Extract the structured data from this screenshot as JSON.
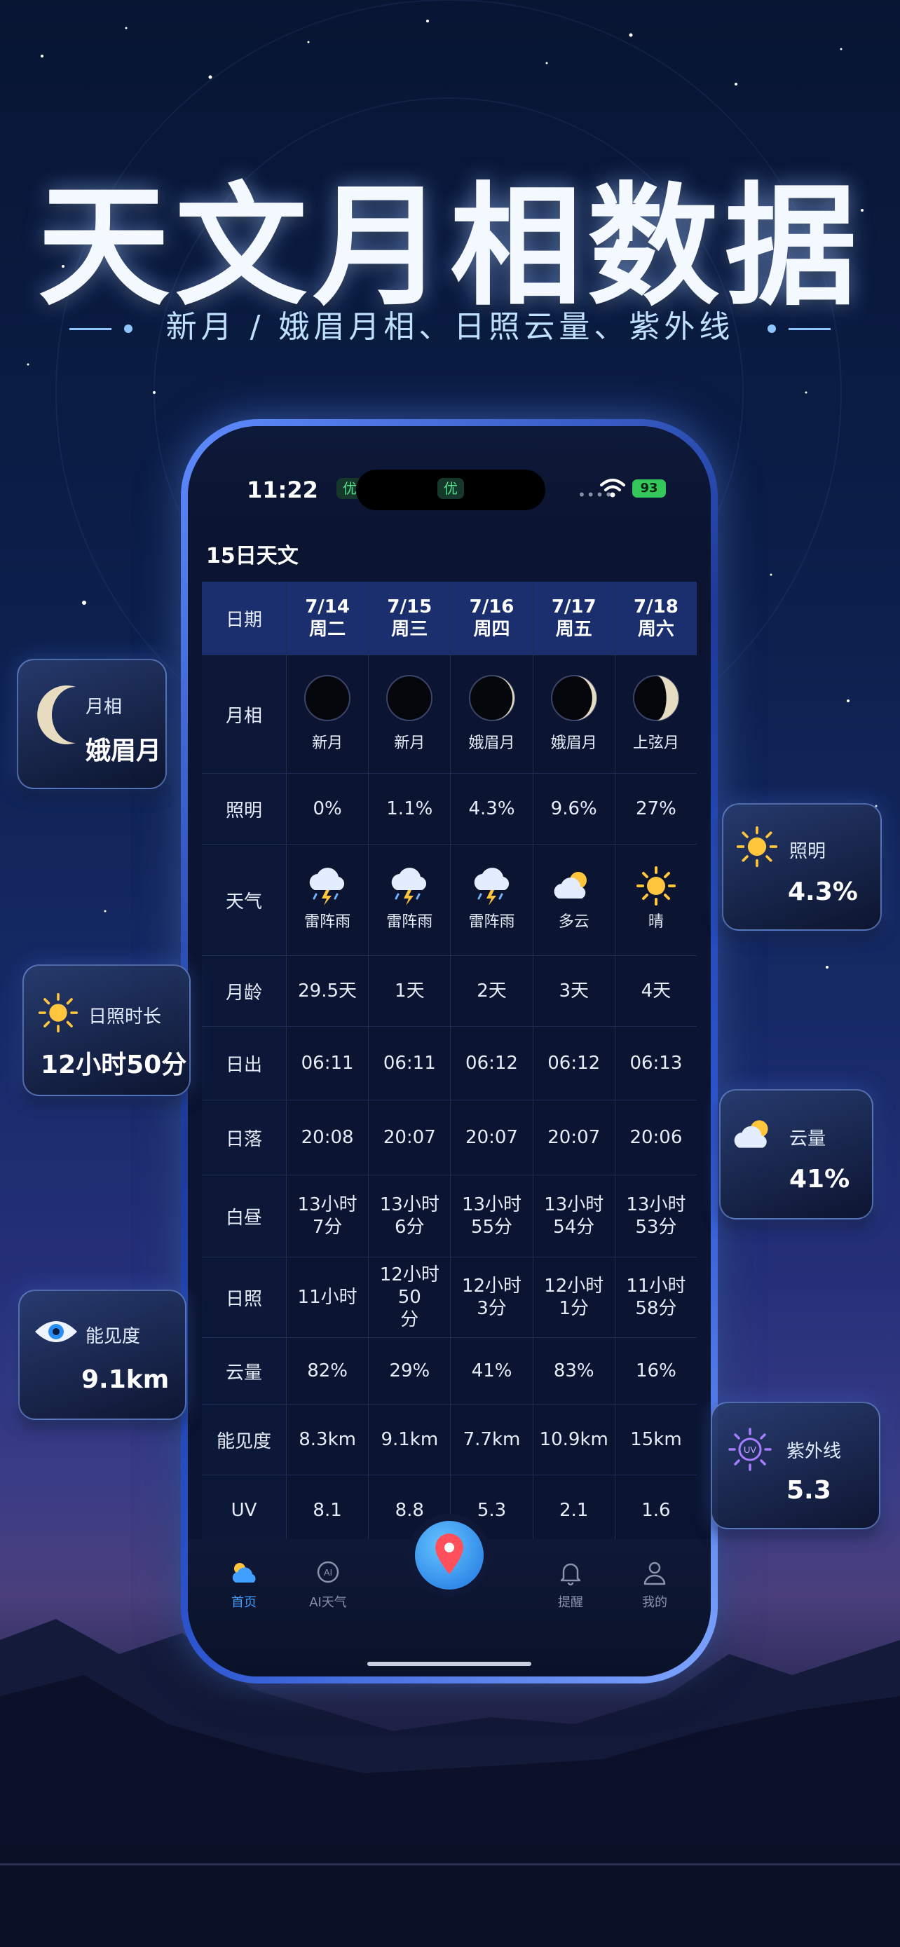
{
  "promo": {
    "headline": "天文月相数据",
    "subline": "新月 / 娥眉月相、日照云量、紫外线"
  },
  "status_bar": {
    "time": "11:22",
    "aqi_1": "优",
    "aqi_2": "优",
    "battery": "93"
  },
  "section_title": "15日天文",
  "table": {
    "header_label": "日期",
    "days": [
      {
        "date": "7/14",
        "weekday": "周二"
      },
      {
        "date": "7/15",
        "weekday": "周三"
      },
      {
        "date": "7/16",
        "weekday": "周四"
      },
      {
        "date": "7/17",
        "weekday": "周五"
      },
      {
        "date": "7/18",
        "weekday": "周六"
      }
    ],
    "rows": {
      "moon_phase": {
        "label": "月相",
        "values": [
          "新月",
          "新月",
          "娥眉月",
          "娥眉月",
          "上弦月"
        ],
        "illumination": [
          0,
          0.011,
          0.043,
          0.096,
          0.27
        ]
      },
      "illumination": {
        "label": "照明",
        "values": [
          "0%",
          "1.1%",
          "4.3%",
          "9.6%",
          "27%"
        ]
      },
      "weather": {
        "label": "天气",
        "values": [
          "雷阵雨",
          "雷阵雨",
          "雷阵雨",
          "多云",
          "晴"
        ],
        "icons": [
          "thunderstorm-icon",
          "thunderstorm-icon",
          "thunderstorm-icon",
          "partly-cloudy-icon",
          "sun-icon"
        ]
      },
      "moon_age": {
        "label": "月龄",
        "values": [
          "29.5天",
          "1天",
          "2天",
          "3天",
          "4天"
        ]
      },
      "sunrise": {
        "label": "日出",
        "values": [
          "06:11",
          "06:11",
          "06:12",
          "06:12",
          "06:13"
        ]
      },
      "sunset": {
        "label": "日落",
        "values": [
          "20:08",
          "20:07",
          "20:07",
          "20:07",
          "20:06"
        ]
      },
      "daylight": {
        "label": "白昼",
        "values": [
          [
            "13小时",
            "7分"
          ],
          [
            "13小时",
            "6分"
          ],
          [
            "13小时",
            "55分"
          ],
          [
            "13小时",
            "54分"
          ],
          [
            "13小时",
            "53分"
          ]
        ]
      },
      "sunshine": {
        "label": "日照",
        "values": [
          [
            "11小时",
            ""
          ],
          [
            "12小时50",
            "分"
          ],
          [
            "12小时",
            "3分"
          ],
          [
            "12小时",
            "1分"
          ],
          [
            "11小时",
            "58分"
          ]
        ]
      },
      "cloud": {
        "label": "云量",
        "values": [
          "82%",
          "29%",
          "41%",
          "83%",
          "16%"
        ]
      },
      "visibility": {
        "label": "能见度",
        "values": [
          "8.3km",
          "9.1km",
          "7.7km",
          "10.9km",
          "15km"
        ]
      },
      "uv": {
        "label": "UV",
        "values": [
          "8.1",
          "8.8",
          "5.3",
          "2.1",
          "1.6"
        ]
      }
    }
  },
  "nav": {
    "home": "首页",
    "ai_weather": "AI天气",
    "ai_badge": "AI",
    "reminder": "提醒",
    "mine": "我的"
  },
  "cards": {
    "moon": {
      "title": "月相",
      "value": "娥眉月"
    },
    "illumination": {
      "title": "照明",
      "value": "4.3%"
    },
    "sunshine": {
      "title": "日照时长",
      "value": "12小时50分"
    },
    "cloud": {
      "title": "云量",
      "value": "41%"
    },
    "visibility": {
      "title": "能见度",
      "value": "9.1km"
    },
    "uv": {
      "title": "紫外线",
      "value": "5.3",
      "badge": "UV"
    }
  },
  "colors": {
    "accent": "#3fa0ff",
    "time_yellow": "#ffd67a",
    "duration_green": "#8cf07f",
    "cloud_orange": "#ffb070",
    "uv_purple": "#c98cff",
    "header_blue": "#1b2f6e"
  }
}
